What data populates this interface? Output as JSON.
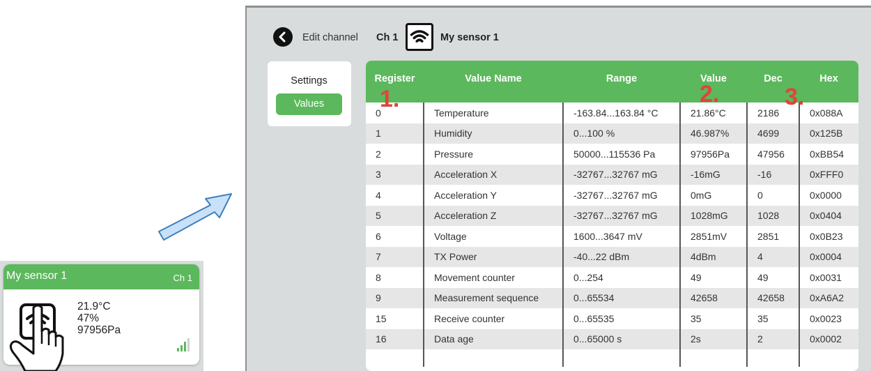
{
  "card": {
    "title": "My sensor 1",
    "channel": "Ch 1",
    "temperature": "21.9°C",
    "humidity": "47%",
    "pressure": "97956Pa",
    "icon": "wifi-sensor-icon"
  },
  "header": {
    "back_label": "Edit channel",
    "channel": "Ch 1",
    "sensor_name": "My sensor 1"
  },
  "sidebar": {
    "items": [
      {
        "label": "Settings",
        "active": false
      },
      {
        "label": "Values",
        "active": true
      }
    ]
  },
  "table": {
    "columns": [
      "Register",
      "Value Name",
      "Range",
      "Value",
      "Dec",
      "Hex"
    ],
    "rows": [
      {
        "register": "0",
        "name": "Temperature",
        "range": "-163.84...163.84 °C",
        "value": "21.86°C",
        "dec": "2186",
        "hex": "0x088A"
      },
      {
        "register": "1",
        "name": "Humidity",
        "range": "0...100 %",
        "value": "46.987%",
        "dec": "4699",
        "hex": "0x125B"
      },
      {
        "register": "2",
        "name": "Pressure",
        "range": "50000...115536 Pa",
        "value": "97956Pa",
        "dec": "47956",
        "hex": "0xBB54"
      },
      {
        "register": "3",
        "name": "Acceleration X",
        "range": "-32767...32767 mG",
        "value": "-16mG",
        "dec": "-16",
        "hex": "0xFFF0"
      },
      {
        "register": "4",
        "name": "Acceleration Y",
        "range": "-32767...32767 mG",
        "value": "0mG",
        "dec": "0",
        "hex": "0x0000"
      },
      {
        "register": "5",
        "name": "Acceleration Z",
        "range": "-32767...32767 mG",
        "value": "1028mG",
        "dec": "1028",
        "hex": "0x0404"
      },
      {
        "register": "6",
        "name": "Voltage",
        "range": "1600...3647 mV",
        "value": "2851mV",
        "dec": "2851",
        "hex": "0x0B23"
      },
      {
        "register": "7",
        "name": "TX Power",
        "range": "-40...22 dBm",
        "value": "4dBm",
        "dec": "4",
        "hex": "0x0004"
      },
      {
        "register": "8",
        "name": "Movement counter",
        "range": "0...254",
        "value": "49",
        "dec": "49",
        "hex": "0x0031"
      },
      {
        "register": "9",
        "name": "Measurement sequence",
        "range": "0...65534",
        "value": "42658",
        "dec": "42658",
        "hex": "0xA6A2"
      },
      {
        "register": "15",
        "name": "Receive counter",
        "range": "0...65535",
        "value": "35",
        "dec": "35",
        "hex": "0x0023"
      },
      {
        "register": "16",
        "name": "Data age",
        "range": "0...65000 s",
        "value": "2s",
        "dec": "2",
        "hex": "0x0002"
      }
    ]
  },
  "markers": [
    "1.",
    "2.",
    "3."
  ],
  "colors": {
    "accent": "#5cb85c",
    "marker": "#e0443b",
    "panel_bg": "#d8dcdc",
    "arrow": "#c9e1f8"
  }
}
